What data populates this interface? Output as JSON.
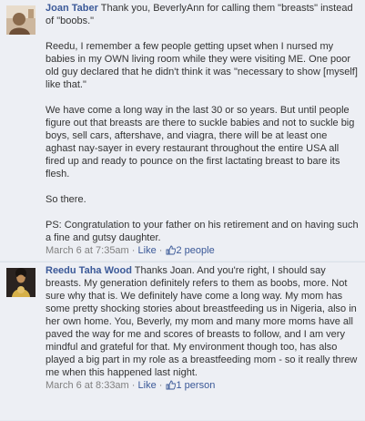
{
  "comments": [
    {
      "author": "Joan Taber",
      "avatar_icon": "profile-photo",
      "paragraphs": [
        "Thank you, BeverlyAnn for calling them \"breasts\" instead of \"boobs.\"",
        "Reedu, I remember a few people getting upset when I nursed my babies in my OWN living room while they were visiting ME. One poor old guy declared that he didn't think it was \"necessary to show [myself] like that.\"",
        "We have come a long way in the last 30 or so years. But until people figure out that breasts are there to suckle babies and not to suckle big boys, sell cars, aftershave, and viagra, there will be at least one aghast nay-sayer in every restaurant throughout the entire USA all fired up and ready to pounce on the first lactating breast to bare its flesh.",
        "So there.",
        "PS: Congratulation to your father on his retirement and on having such a fine and gutsy daughter."
      ],
      "timestamp": "March 6 at 7:35am",
      "sep": "·",
      "like_label": "Like",
      "like_icon": "thumbs-up-icon",
      "like_count": "2 people"
    },
    {
      "author": "Reedu Taha Wood",
      "avatar_icon": "profile-photo",
      "text": "Thanks Joan. And you're right, I should say breasts. My generation definitely refers to them as boobs, more. Not sure why that is. We definitely have come a long way. My mom has some pretty shocking stories about breastfeeding us in Nigeria, also in her own home. You, Beverly, my mom and many more moms have all paved the way for me and scores of breasts to follow, and I am very mindful and grateful for that. My environment though too, has also played a big part in my role as a breastfeeding mom - so it really threw me when this happened last night.",
      "timestamp": "March 6 at 8:33am",
      "sep": "·",
      "like_label": "Like",
      "like_icon": "thumbs-up-icon",
      "like_count": "1 person"
    }
  ],
  "colors": {
    "comment_bg": "#edeff4",
    "link": "#3b5998",
    "meta_gray": "#808080",
    "text": "#333333"
  }
}
